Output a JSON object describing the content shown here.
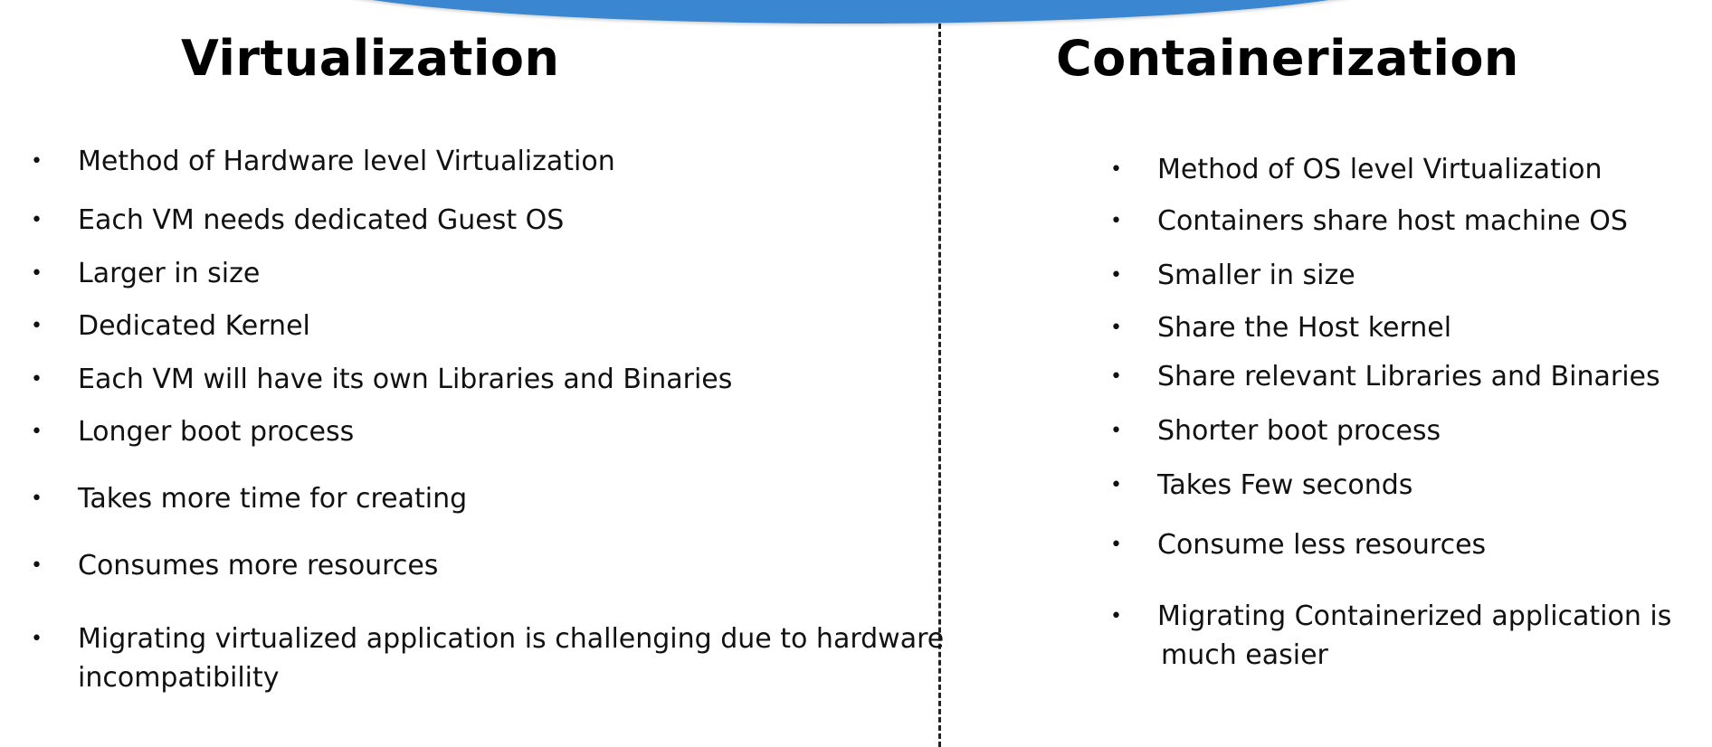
{
  "left": {
    "title": "Virtualization",
    "items": [
      "Method of Hardware level Virtualization",
      "Each VM needs dedicated Guest OS",
      "Larger in size",
      "Dedicated Kernel",
      "Each VM will have its own Libraries and Binaries",
      "Longer boot process",
      "Takes more time for creating",
      "Consumes more resources",
      "Migrating virtualized application is challenging due to hardware",
      "incompatibility"
    ]
  },
  "right": {
    "title": "Containerization",
    "items": [
      "Method of OS level Virtualization",
      "Containers share host machine OS",
      "Smaller in size",
      "Share the Host kernel",
      "Share relevant Libraries and Binaries",
      "Shorter boot process",
      "Takes Few seconds",
      "Consume less resources",
      "Migrating Containerized application is",
      "much easier"
    ]
  },
  "bullet_symbol": "•",
  "colors": {
    "arc": "#3a86d0",
    "text": "#111111",
    "divider": "#222222"
  }
}
